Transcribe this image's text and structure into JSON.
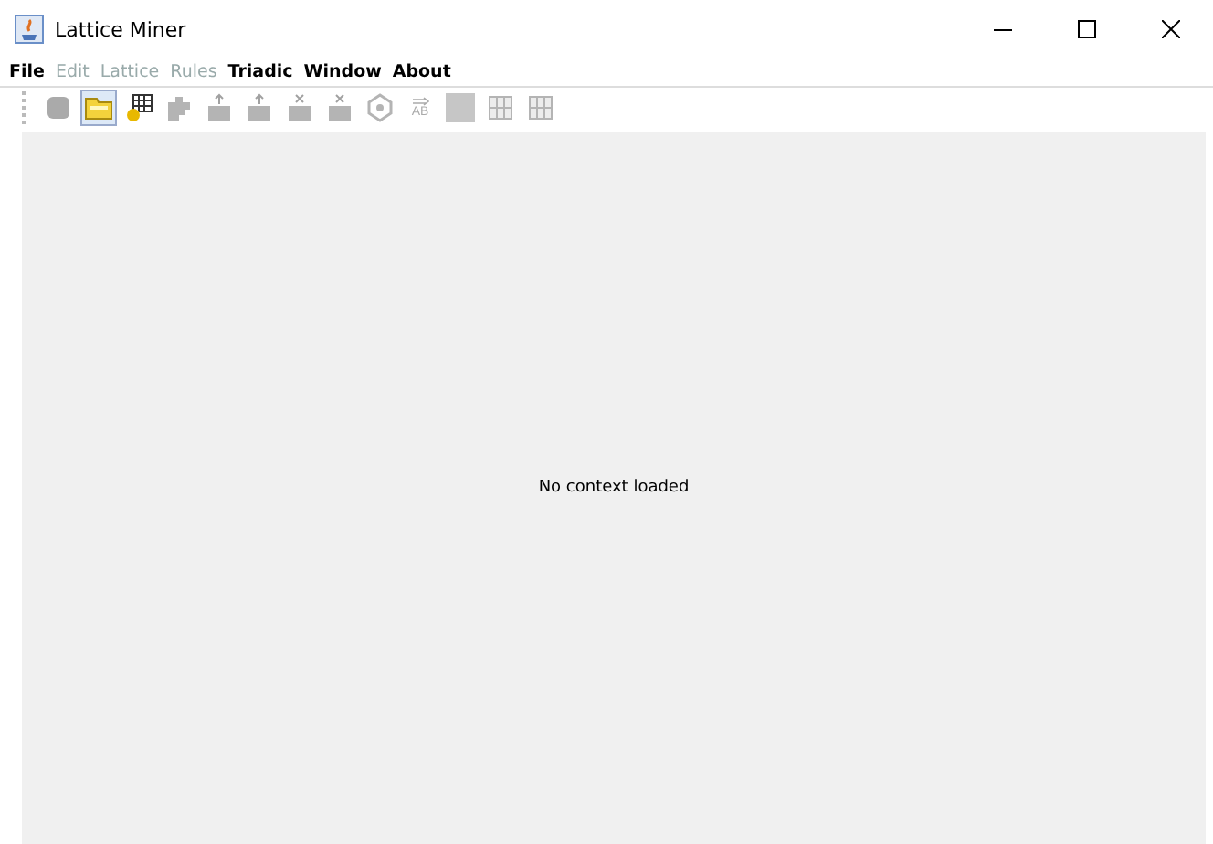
{
  "window": {
    "title": "Lattice Miner"
  },
  "menu": [
    {
      "label": "File",
      "disabled": false
    },
    {
      "label": "Edit",
      "disabled": true
    },
    {
      "label": "Lattice",
      "disabled": true
    },
    {
      "label": "Rules",
      "disabled": true
    },
    {
      "label": "Triadic",
      "disabled": false
    },
    {
      "label": "Window",
      "disabled": false
    },
    {
      "label": "About",
      "disabled": false
    }
  ],
  "toolbar": [
    {
      "kind": "database",
      "disabled": true,
      "selected": false
    },
    {
      "kind": "folder",
      "disabled": false,
      "selected": true
    },
    {
      "kind": "table-gear",
      "disabled": false,
      "selected": false
    },
    {
      "kind": "puzzle",
      "disabled": true,
      "selected": false
    },
    {
      "kind": "table-add",
      "disabled": true,
      "selected": false
    },
    {
      "kind": "table-add",
      "disabled": true,
      "selected": false
    },
    {
      "kind": "table-remove",
      "disabled": true,
      "selected": false
    },
    {
      "kind": "table-remove",
      "disabled": true,
      "selected": false
    },
    {
      "kind": "network",
      "disabled": true,
      "selected": false
    },
    {
      "kind": "arrow-text",
      "label": "AB",
      "disabled": true,
      "selected": false
    },
    {
      "kind": "block",
      "disabled": true,
      "selected": false
    },
    {
      "kind": "grid",
      "disabled": true,
      "selected": false
    },
    {
      "kind": "grid",
      "disabled": true,
      "selected": false
    }
  ],
  "content": {
    "message": "No context loaded"
  }
}
